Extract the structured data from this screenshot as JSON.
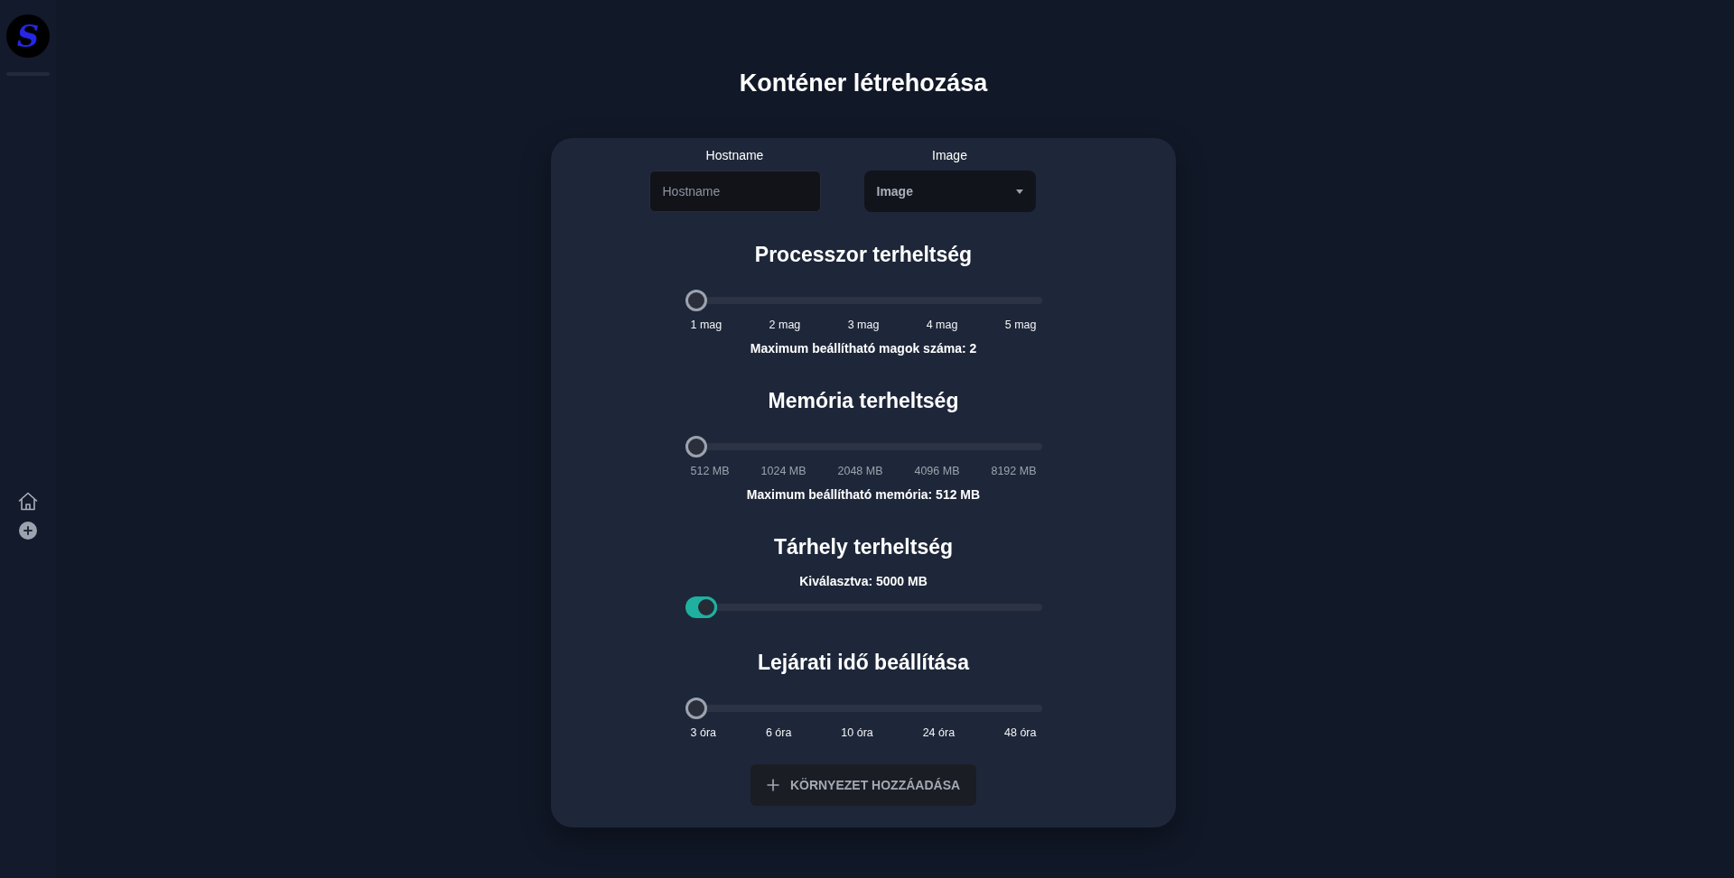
{
  "sidebar": {
    "logo": {
      "text": "S"
    }
  },
  "title": "Konténer létrehozása",
  "form": {
    "fields": [
      {
        "kind": "text",
        "label": "Hostname",
        "placeholder": "Hostname"
      },
      {
        "kind": "select",
        "label": "Image",
        "placeholder": "Image"
      }
    ],
    "sections": [
      {
        "kind": "stepped",
        "title": "Processzor terheltség",
        "level": 0,
        "marks": [
          "1 mag",
          "2 mag",
          "3 mag",
          "4 mag",
          "5 mag"
        ],
        "dimmed": false,
        "note": "Maximum beállítható magok száma: 2"
      },
      {
        "kind": "stepped",
        "title": "Memória terheltség",
        "level": 0,
        "marks": [
          "512 MB",
          "1024 MB",
          "2048 MB",
          "4096 MB",
          "8192 MB"
        ],
        "dimmed": true,
        "note": "Maximum beállítható memória: 512 MB"
      },
      {
        "kind": "continuous",
        "title": "Tárhely terheltség",
        "note": "Kiválasztva: 5000 MB",
        "level": 0.03
      },
      {
        "kind": "stepped",
        "title": "Lejárati idő beállítása",
        "level": 0,
        "marks": [
          "3 óra",
          "6 óra",
          "10 óra",
          "24 óra",
          "48 óra"
        ],
        "dimmed": false
      }
    ],
    "submit_button": {
      "label": "KÖRNYEZET HOZZÁADÁSA"
    }
  }
}
